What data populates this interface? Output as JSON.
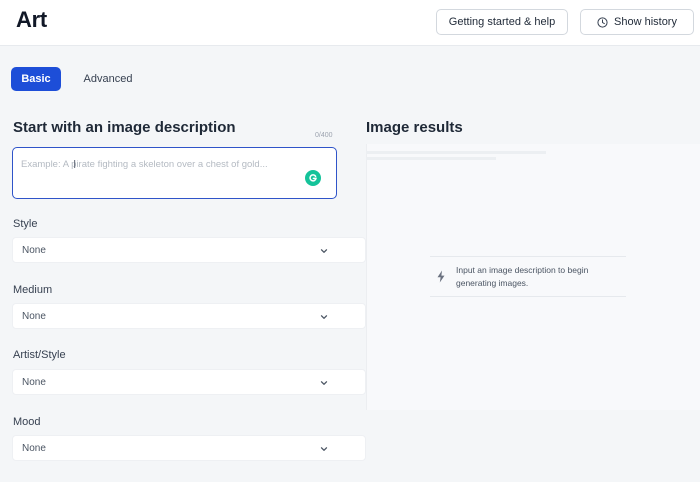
{
  "header": {
    "title": "Art",
    "help_button": "Getting started & help",
    "history_button": "Show history"
  },
  "tabs": [
    {
      "label": "Basic",
      "active": true
    },
    {
      "label": "Advanced",
      "active": false
    }
  ],
  "description": {
    "title": "Start with an image description",
    "char_count": "0/400",
    "placeholder": "Example: A pirate fighting a skeleton over a chest of gold...",
    "value": ""
  },
  "fields": {
    "style": {
      "label": "Style",
      "value": "None"
    },
    "medium": {
      "label": "Medium",
      "value": "None"
    },
    "artist": {
      "label": "Artist/Style",
      "value": "None"
    },
    "mood": {
      "label": "Mood",
      "value": "None"
    }
  },
  "results": {
    "title": "Image results",
    "empty_message": "Input an image description to begin generating images."
  },
  "colors": {
    "accent": "#1d4ed8",
    "input_border": "#2f54c9",
    "grammarly": "#15c39a"
  },
  "icons": [
    "clock-icon",
    "grammarly-icon",
    "chevron-down-icon",
    "bolt-icon",
    "text-cursor-icon"
  ]
}
